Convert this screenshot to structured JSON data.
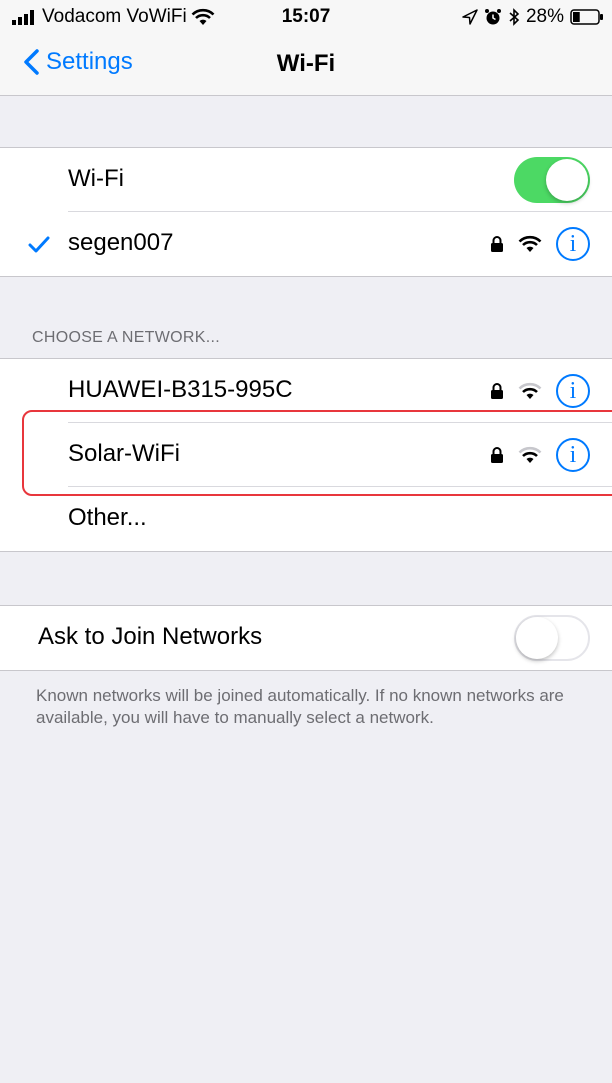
{
  "status_bar": {
    "carrier": "Vodacom VoWiFi",
    "time": "15:07",
    "battery_percent": "28%",
    "battery_level": 0.28
  },
  "nav": {
    "back_label": "Settings",
    "title": "Wi-Fi"
  },
  "wifi_section": {
    "toggle_label": "Wi-Fi",
    "toggle_on": true,
    "connected_network": "segen007"
  },
  "networks_section": {
    "header": "CHOOSE A NETWORK...",
    "networks": [
      {
        "name": "HUAWEI-B315-995C",
        "secured": true
      },
      {
        "name": "Solar-WiFi",
        "secured": true,
        "highlighted": true
      }
    ],
    "other_label": "Other..."
  },
  "ask_section": {
    "label": "Ask to Join Networks",
    "toggle_on": false,
    "footer": "Known networks will be joined automatically. If no known networks are available, you will have to manually select a network."
  },
  "colors": {
    "accent": "#007aff",
    "toggle_on": "#4cd964",
    "highlight": "#e8363c",
    "background": "#efeff4"
  }
}
